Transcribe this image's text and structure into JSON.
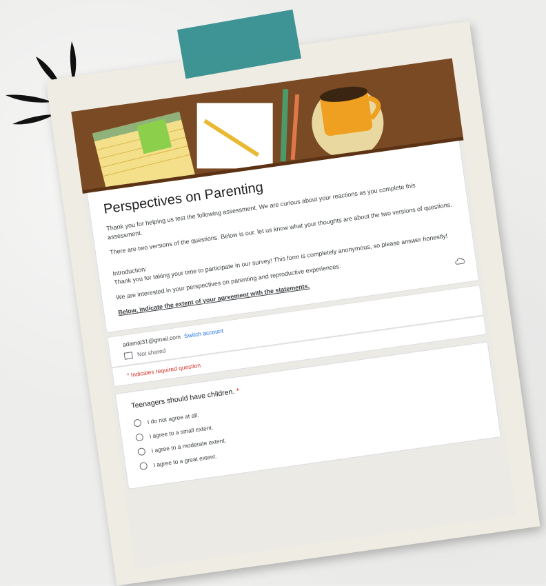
{
  "form": {
    "title": "Perspectives on Parenting",
    "description": [
      "Thank you for helping us test the following assessment. We are curious about your reactions as you complete this assessment.",
      "There are two versions of the questions. Below is our. let us know what your thoughts are about the two versions of questions.",
      "Introduction:",
      "Thank you for taking your time to participate in our survey! This form is completely anonymous, so please answer honestly!",
      "We are interested in your perspectives on parenting and reproductive experiences.",
      "Below, indicate the extent of your agreement with the statements."
    ],
    "account": {
      "email": "adamal31@gmail.com",
      "switch_label": "Switch account",
      "shared_status": "Not shared"
    },
    "required_note": "* Indicates required question",
    "question": {
      "title": "Teenagers should have children.",
      "required_mark": "*",
      "options": [
        "I do not agree at all.",
        "I agree to a small extent.",
        "I agree to a moderate extent.",
        "I agree to a great extent."
      ]
    }
  },
  "colors": {
    "tape": "#2f8b8c",
    "banner": "#7a4a25",
    "accent_link": "#1a73e8",
    "required": "#d93025"
  },
  "icons": [
    "cloud-save-icon",
    "not-shared-icon",
    "radio-empty-icon"
  ]
}
